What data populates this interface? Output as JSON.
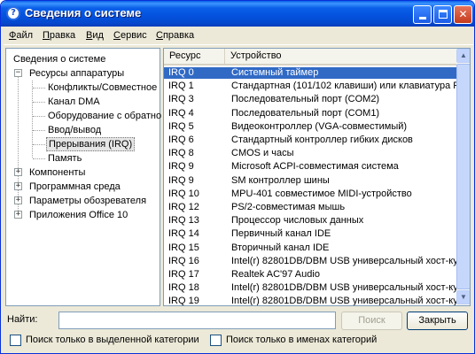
{
  "window": {
    "title": "Сведения о системе",
    "minimize": "",
    "maximize": "",
    "close": "✕",
    "app_icon": "?"
  },
  "menu": [
    {
      "label": "Файл",
      "key": "Ф"
    },
    {
      "label": "Правка",
      "key": "П"
    },
    {
      "label": "Вид",
      "key": "В"
    },
    {
      "label": "Сервис",
      "key": "С"
    },
    {
      "label": "Справка",
      "key": "С"
    }
  ],
  "tree": {
    "root": "Сведения о системе",
    "hardware": "Ресурсы аппаратуры",
    "hardware_children": [
      "Конфликты/Совместное",
      "Канал DMA",
      "Оборудование с обратно",
      "Ввод/вывод",
      "Прерывания (IRQ)",
      "Память"
    ],
    "selected_child": "Прерывания (IRQ)",
    "others": [
      "Компоненты",
      "Программная среда",
      "Параметры обозревателя",
      "Приложения Office 10"
    ],
    "expand_minus": "−",
    "expand_plus": "+"
  },
  "list": {
    "columns": [
      "Ресурс",
      "Устройство"
    ],
    "rows": [
      {
        "res": "IRQ 0",
        "dev": "Системный таймер"
      },
      {
        "res": "IRQ 1",
        "dev": "Стандартная (101/102 клавиши) или клавиатура P"
      },
      {
        "res": "IRQ 3",
        "dev": "Последовательный порт (COM2)"
      },
      {
        "res": "IRQ 4",
        "dev": "Последовательный порт (COM1)"
      },
      {
        "res": "IRQ 5",
        "dev": "Видеоконтроллер (VGA-совместимый)"
      },
      {
        "res": "IRQ 6",
        "dev": "Стандартный контроллер гибких дисков"
      },
      {
        "res": "IRQ 8",
        "dev": "CMOS и часы"
      },
      {
        "res": "IRQ 9",
        "dev": "Microsoft ACPI-совместимая система"
      },
      {
        "res": "IRQ 9",
        "dev": "SM контроллер шины"
      },
      {
        "res": "IRQ 10",
        "dev": "MPU-401 совместимое MIDI-устройство"
      },
      {
        "res": "IRQ 12",
        "dev": "PS/2-совместимая мышь"
      },
      {
        "res": "IRQ 13",
        "dev": "Процессор числовых данных"
      },
      {
        "res": "IRQ 14",
        "dev": "Первичный канал IDE"
      },
      {
        "res": "IRQ 15",
        "dev": "Вторичный канал IDE"
      },
      {
        "res": "IRQ 16",
        "dev": "Intel(r) 82801DB/DBM USB универсальный хост-ку"
      },
      {
        "res": "IRQ 17",
        "dev": "Realtek AC'97 Audio"
      },
      {
        "res": "IRQ 18",
        "dev": "Intel(r) 82801DB/DBM USB универсальный хост-ку"
      },
      {
        "res": "IRQ 19",
        "dev": "Intel(r) 82801DB/DBM USB универсальный хост-ку"
      }
    ],
    "selected_index": 0,
    "scroll_up": "▲",
    "scroll_down": "▼"
  },
  "find": {
    "label": "Найти:",
    "value": "",
    "search_button": "Поиск",
    "close_button": "Закрыть",
    "checkbox_selected_category": "Поиск только в выделенной категории",
    "checkbox_category_names": "Поиск только в именах категорий",
    "checkbox_selected_category_checked": false,
    "checkbox_category_names_checked": false
  },
  "colors": {
    "selection": "#316ac5",
    "titlebar": "#0553e0"
  }
}
